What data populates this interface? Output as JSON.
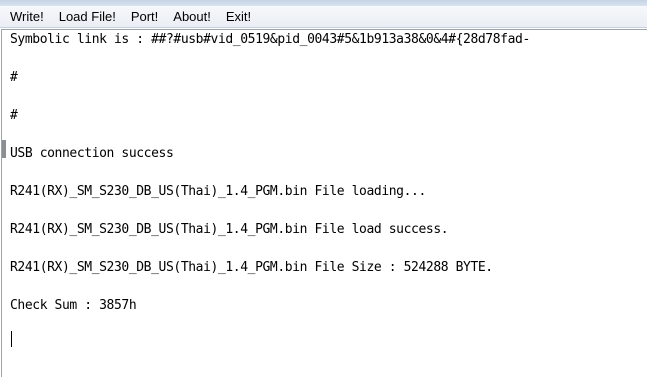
{
  "menu": {
    "write": "Write!",
    "load_file": "Load File!",
    "port": "Port!",
    "about": "About!",
    "exit": "Exit!"
  },
  "log": {
    "lines": [
      "Symbolic link is : ##?#usb#vid_0519&pid_0043#5&1b913a38&0&4#{28d78fad-",
      "#",
      "#",
      "USB connection success",
      "R241(RX)_SM_S230_DB_US(Thai)_1.4_PGM.bin File loading...",
      "R241(RX)_SM_S230_DB_US(Thai)_1.4_PGM.bin File load success.",
      "R241(RX)_SM_S230_DB_US(Thai)_1.4_PGM.bin File Size : 524288 BYTE.",
      "Check Sum : 3857h"
    ]
  }
}
